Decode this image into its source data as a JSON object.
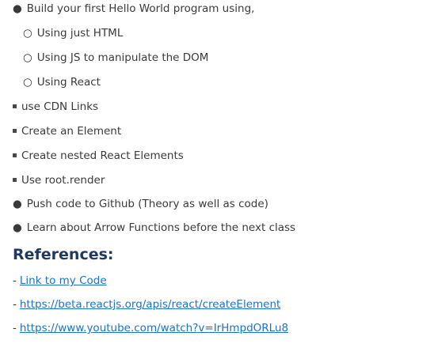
{
  "bullets": {
    "b1": "Build your first Hello World program using,",
    "s1": "Using just HTML",
    "s2": "Using JS to manipulate the DOM",
    "s3": "Using React",
    "q1": "use CDN Links",
    "q2": "Create an Element",
    "q3": "Create nested React Elements",
    "q4": "Use root.render",
    "b2": "Push code to Github (Theory as well as code)",
    "b3": "Learn about Arrow Functions before the next class"
  },
  "markers": {
    "bullet": "●",
    "circle": "○",
    "dash": "-"
  },
  "references": {
    "title": "References:",
    "links": [
      "Link to my Code",
      "https://beta.reactjs.org/apis/react/createElement",
      "https://www.youtube.com/watch?v=IrHmpdORLu8"
    ]
  }
}
